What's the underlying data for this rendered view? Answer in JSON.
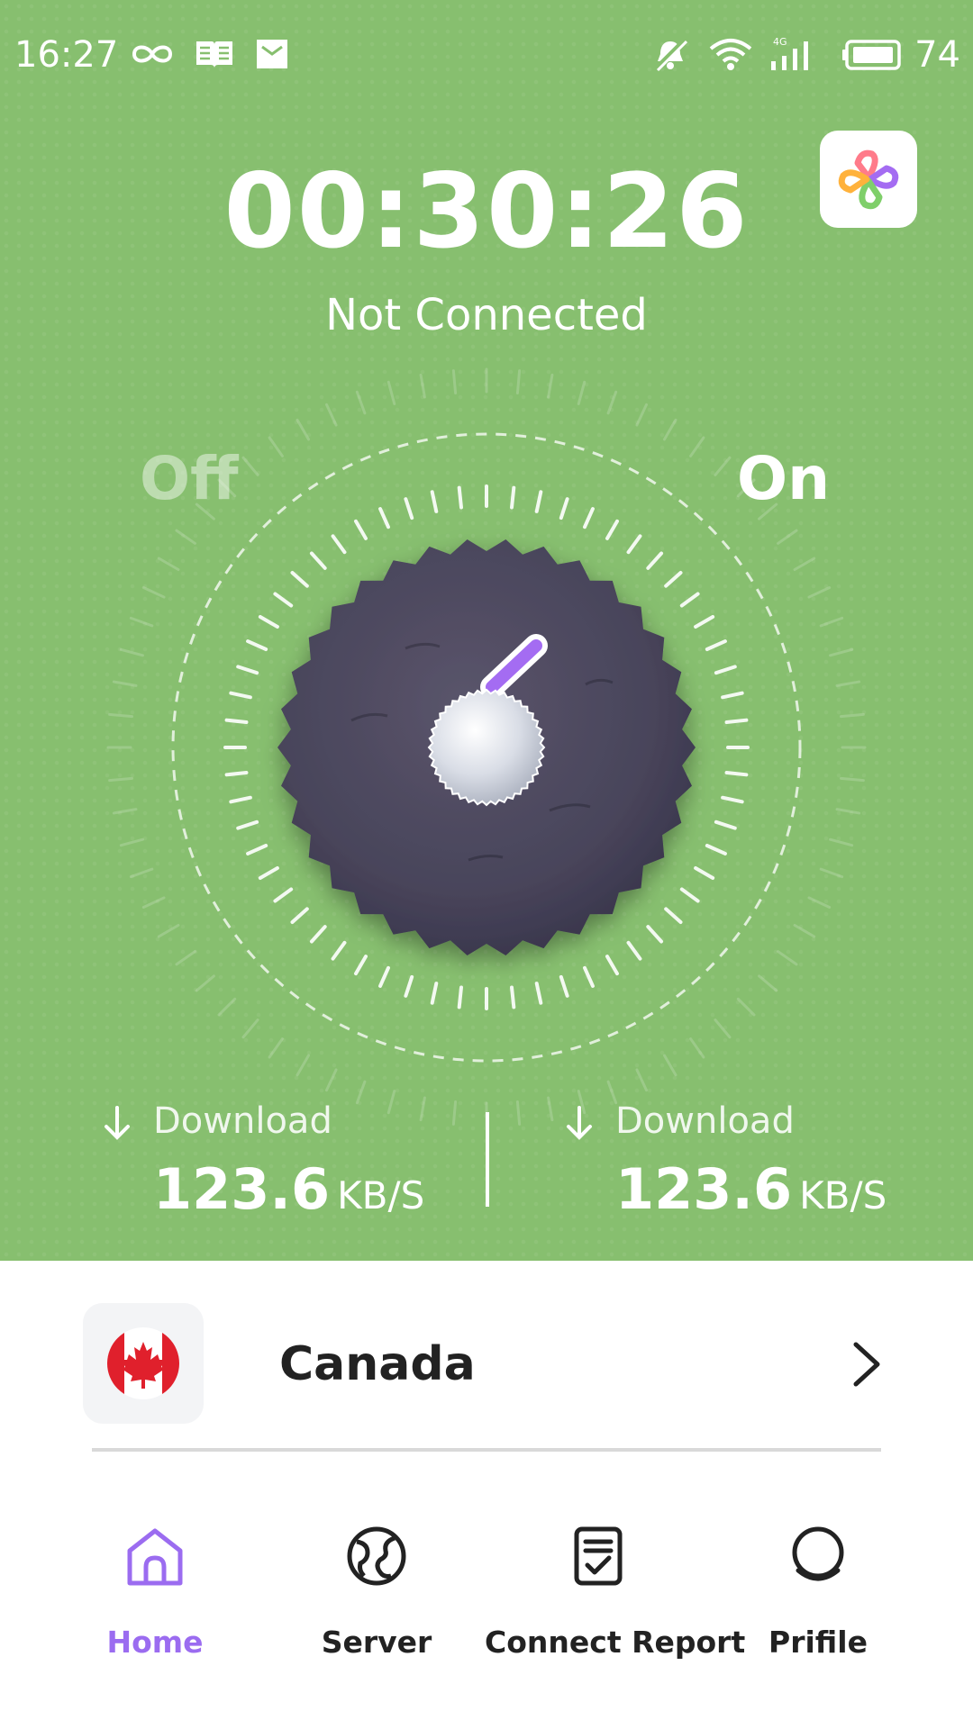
{
  "status_bar": {
    "time": "16:27",
    "battery": "74",
    "network_label": "4G"
  },
  "app": {
    "logo_icon": "clover-logo-icon"
  },
  "connection": {
    "timer": "00:30:26",
    "status": "Not Connected",
    "off_label": "Off",
    "on_label": "On",
    "knob_state": "on"
  },
  "stats": {
    "left": {
      "label": "Download",
      "value": "123.6",
      "unit": "KB/S"
    },
    "right": {
      "label": "Download",
      "value": "123.6",
      "unit": "KB/S"
    }
  },
  "server": {
    "country": "Canada",
    "flag_icon": "canada-flag-icon"
  },
  "nav": {
    "items": [
      {
        "label": "Home",
        "icon": "home-icon",
        "active": true
      },
      {
        "label": "Server",
        "icon": "globe-icon",
        "active": false
      },
      {
        "label": "Connect Report",
        "icon": "report-icon",
        "active": false
      },
      {
        "label": "Prifile",
        "icon": "profile-icon",
        "active": false
      }
    ]
  },
  "colors": {
    "background_green": "#87bf6f",
    "accent_purple": "#9b6cf0",
    "knob_dark": "#4a4659",
    "text_dark": "#222222"
  }
}
